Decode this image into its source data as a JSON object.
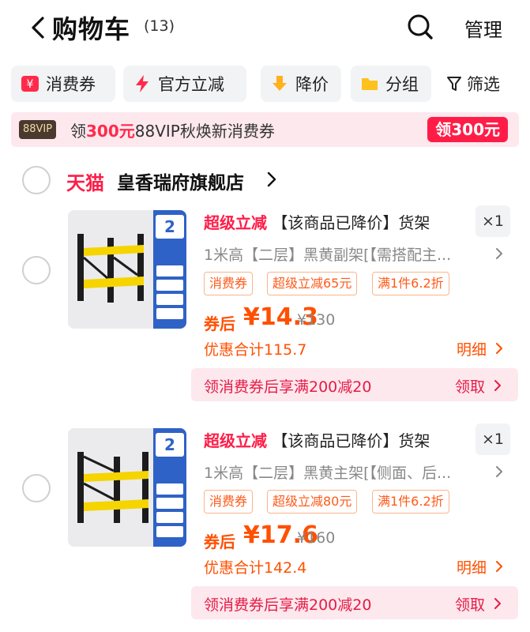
{
  "header": {
    "title": "购物车",
    "count": "(13)",
    "manage": "管理"
  },
  "chips": [
    {
      "label": "消费券",
      "icon": "coupon-icon",
      "color": "#ff2a4c"
    },
    {
      "label": "官方立减",
      "icon": "lightning-icon",
      "color": "#ff2a4c"
    },
    {
      "label": "降价",
      "icon": "price-drop-icon",
      "color": "#ffb21c"
    },
    {
      "label": "分组",
      "icon": "folder-icon",
      "color": "#ffc21c"
    }
  ],
  "filter_label": "筛选",
  "vip_banner": {
    "badge": "88VIP",
    "prefix": "领",
    "amount": "300元",
    "suffix": "88VIP秋焕新消费券",
    "button": "领300元"
  },
  "store": {
    "platform": "天猫",
    "name": "皇香瑞府旗舰店"
  },
  "items": [
    {
      "promo": "超级立减",
      "title": "【该商品已降价】货架",
      "qty": "×1",
      "spec": "1米高【二层】黑黄副架[【需搭配主...",
      "tags": [
        "消费券",
        "超级立减65元",
        "满1件6.2折"
      ],
      "after_label": "券后",
      "price": "¥14.3",
      "original": "¥130",
      "discount": "优惠合计115.7",
      "detail": "明细",
      "coupon_text": "领消费券后享满200减20",
      "coupon_claim": "领取",
      "image_tier": "2"
    },
    {
      "promo": "超级立减",
      "title": "【该商品已降价】货架",
      "qty": "×1",
      "spec": "1米高【二层】黑黄主架[【侧面、后...",
      "tags": [
        "消费券",
        "超级立减80元",
        "满1件6.2折"
      ],
      "after_label": "券后",
      "price": "¥17.6",
      "original": "¥160",
      "discount": "优惠合计142.4",
      "detail": "明细",
      "coupon_text": "领消费券后享满200减20",
      "coupon_claim": "领取",
      "image_tier": "2"
    }
  ]
}
